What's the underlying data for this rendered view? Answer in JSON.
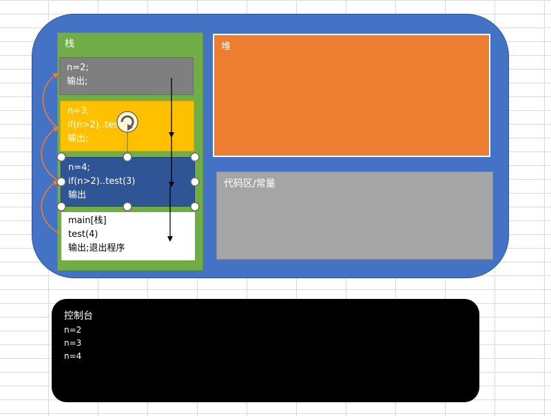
{
  "memory": {
    "stack": {
      "title": "栈",
      "frames": [
        {
          "lines": [
            "n=2;",
            "输出;"
          ]
        },
        {
          "lines": [
            "n=3;",
            "if(n>2)..test(2)",
            "输出;"
          ]
        },
        {
          "lines": [
            "n=4;",
            "if(n>2)..test(3)",
            "输出"
          ]
        },
        {
          "lines": [
            "main[栈]",
            "test(4)",
            "输出;退出程序"
          ]
        }
      ]
    },
    "heap": {
      "title": "堆"
    },
    "code_area": {
      "title": "代码区/常量"
    }
  },
  "console": {
    "title": "控制台",
    "lines": [
      "n=2",
      "n=3",
      "n=4"
    ]
  },
  "colors": {
    "memory": "#4472c4",
    "stack": "#70ad47",
    "frame_n2": "#7f7f7f",
    "frame_n3": "#ffc000",
    "frame_n4": "#2f5597",
    "frame_main": "#ffffff",
    "heap": "#ed7d31",
    "code_area": "#a5a5a5",
    "console": "#000000",
    "return_arrow": "#ed7d31"
  },
  "icons": [
    "rotate-handle-icon"
  ]
}
